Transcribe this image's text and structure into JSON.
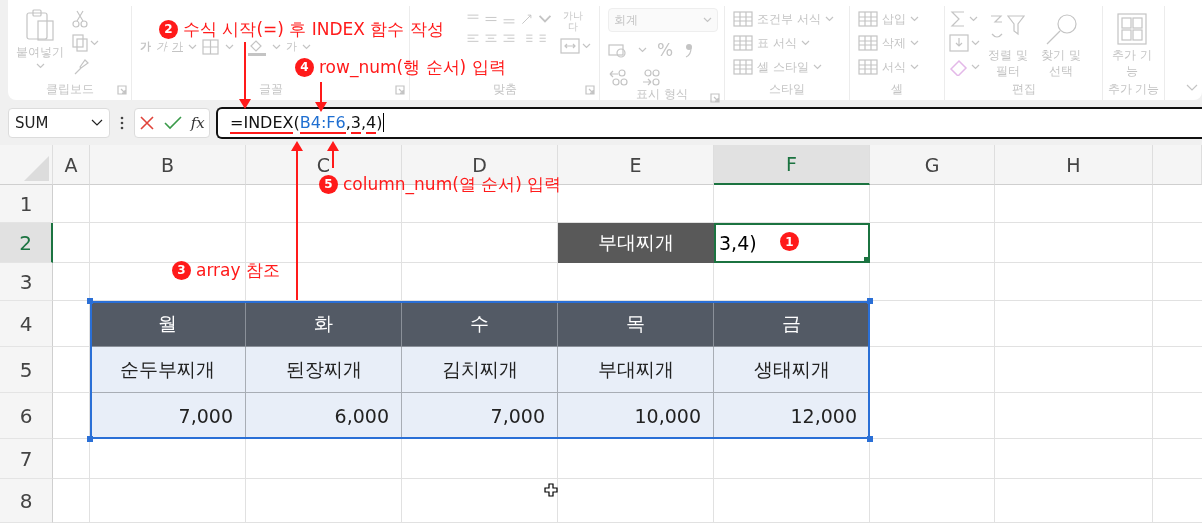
{
  "ribbon": {
    "disabled": true,
    "groups": [
      {
        "kind": "clipboard",
        "label": "클립보드",
        "buttons": [
          {
            "label": "붙여넣기"
          }
        ]
      },
      {
        "kind": "font",
        "label": "글꼴",
        "buttons": [
          {
            "label": "가",
            "kind": "bold"
          },
          {
            "label": "가",
            "kind": "italic"
          },
          {
            "label": "가",
            "kind": "underline"
          },
          {
            "label": "가",
            "kind": "color"
          }
        ]
      },
      {
        "kind": "alignment",
        "label": "맞춤",
        "buttons": [
          {
            "label": "가나다",
            "kind": "wrap"
          }
        ]
      },
      {
        "kind": "number",
        "label": "표시 형식",
        "format": "회계",
        "buttons": [
          {
            "label": "%",
            "kind": "percent"
          }
        ]
      },
      {
        "kind": "styles",
        "label": "스타일",
        "buttons": [
          {
            "label": "조건부 서식"
          },
          {
            "label": "표 서식"
          },
          {
            "label": "셀 스타일"
          }
        ]
      },
      {
        "kind": "cells",
        "label": "셀",
        "buttons": [
          {
            "label": "삽입"
          },
          {
            "label": "삭제"
          },
          {
            "label": "서식"
          }
        ]
      },
      {
        "kind": "editing",
        "label": "편집",
        "buttons": [
          {
            "label": "정렬 및 필터"
          },
          {
            "label": "찾기 및 선택"
          }
        ]
      },
      {
        "kind": "addins",
        "label": "추가 기능",
        "buttons": [
          {
            "label": "추가 기능"
          }
        ]
      }
    ]
  },
  "formula_bar": {
    "name_box": "SUM",
    "function_label": "fx",
    "tokens": [
      {
        "text": "=INDEX",
        "kind": "text",
        "underlined": true
      },
      {
        "text": "(",
        "kind": "text",
        "underlined": false
      },
      {
        "text": "B4:F6",
        "kind": "ref",
        "underlined": true
      },
      {
        "text": ",",
        "kind": "text",
        "underlined": false
      },
      {
        "text": "3",
        "kind": "text",
        "underlined": true
      },
      {
        "text": ",",
        "kind": "text",
        "underlined": false
      },
      {
        "text": "4",
        "kind": "text",
        "underlined": true
      },
      {
        "text": ")",
        "kind": "text",
        "underlined": false
      }
    ]
  },
  "sheet": {
    "columns": [
      {
        "label": "A",
        "selected": false
      },
      {
        "label": "B",
        "selected": false
      },
      {
        "label": "C",
        "selected": false
      },
      {
        "label": "D",
        "selected": false
      },
      {
        "label": "E",
        "selected": false
      },
      {
        "label": "F",
        "selected": true
      },
      {
        "label": "G",
        "selected": false
      },
      {
        "label": "H",
        "selected": false
      }
    ],
    "rows": [
      {
        "label": "1",
        "selected": false
      },
      {
        "label": "2",
        "selected": true
      },
      {
        "label": "3",
        "selected": false
      },
      {
        "label": "4",
        "selected": false
      },
      {
        "label": "5",
        "selected": false
      },
      {
        "label": "6",
        "selected": false
      },
      {
        "label": "7",
        "selected": false
      },
      {
        "label": "8",
        "selected": false
      }
    ],
    "lookup": {
      "label": "부대찌개",
      "value": "3,4)"
    },
    "table": {
      "header": [
        "월",
        "화",
        "수",
        "목",
        "금"
      ],
      "rows": [
        [
          "순두부찌개",
          "된장찌개",
          "김치찌개",
          "부대찌개",
          "생태찌개"
        ],
        [
          "7,000",
          "6,000",
          "7,000",
          "10,000",
          "12,000"
        ]
      ]
    }
  },
  "annotations": [
    {
      "number": "2",
      "text": "수식 시작(=) 후 INDEX 함수 작성"
    },
    {
      "number": "4",
      "text": "row_num(행 순서) 입력"
    },
    {
      "number": "5",
      "text": "column_num(열 순서) 입력"
    },
    {
      "number": "1"
    },
    {
      "number": "3",
      "text": "array 참조"
    }
  ]
}
